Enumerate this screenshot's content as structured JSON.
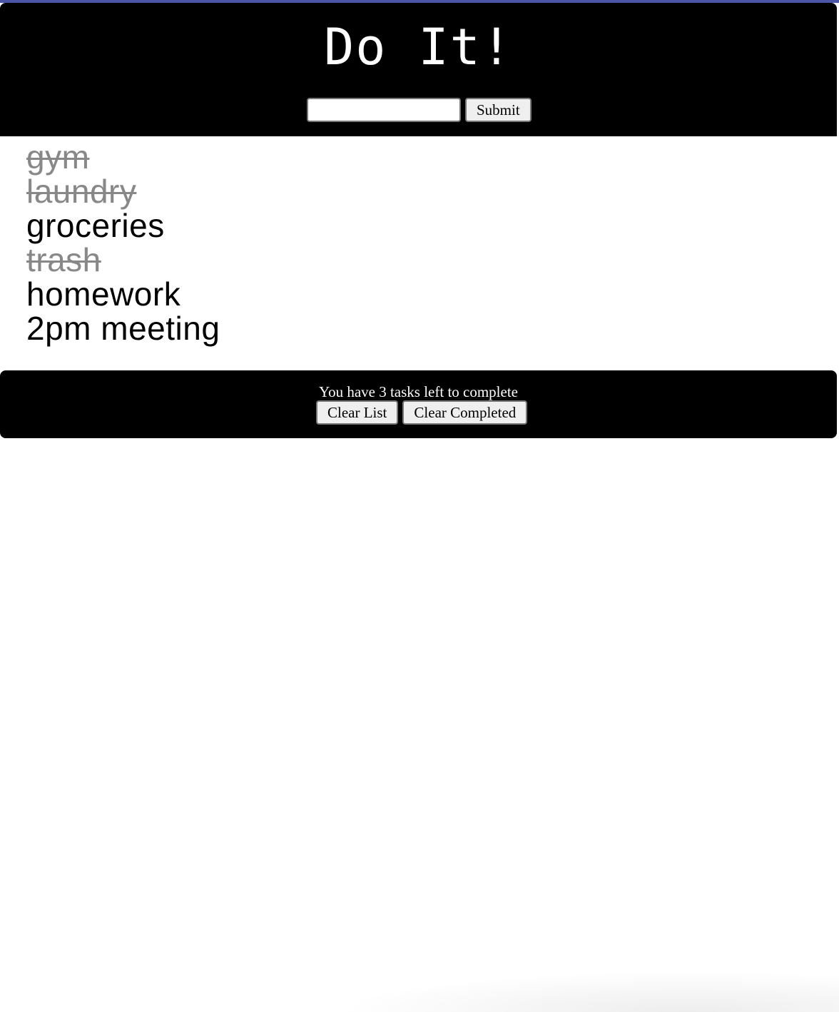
{
  "app": {
    "title": "Do It!"
  },
  "form": {
    "input_value": "",
    "submit_label": "Submit"
  },
  "tasks": [
    {
      "label": "gym",
      "completed": true
    },
    {
      "label": "laundry",
      "completed": true
    },
    {
      "label": "groceries",
      "completed": false
    },
    {
      "label": "trash",
      "completed": true
    },
    {
      "label": "homework",
      "completed": false
    },
    {
      "label": "2pm meeting",
      "completed": false
    }
  ],
  "footer": {
    "remaining_text": "You have 3 tasks left to complete",
    "clear_list_label": "Clear List",
    "clear_completed_label": "Clear Completed"
  },
  "colors": {
    "accent_border": "#4b55a8",
    "header_bg": "#000000",
    "completed_text": "#888888"
  }
}
